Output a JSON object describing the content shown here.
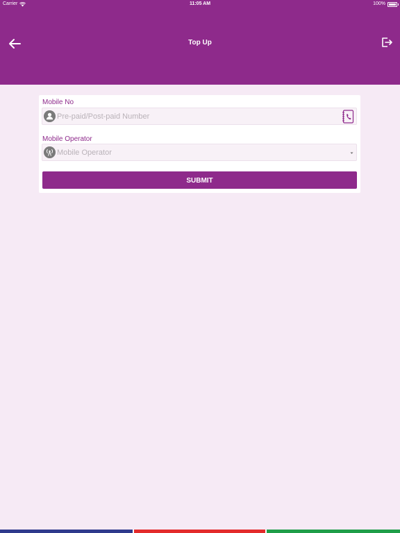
{
  "status_bar": {
    "carrier": "Carrier",
    "time": "11:05 AM",
    "battery": "100%"
  },
  "header": {
    "title": "Top Up",
    "back_icon": "arrow-left-icon",
    "logout_icon": "logout-icon"
  },
  "form": {
    "mobile_label": "Mobile No",
    "mobile_placeholder": "Pre-paid/Post-paid Number",
    "mobile_value": "",
    "operator_label": "Mobile Operator",
    "operator_placeholder": "Mobile Operator",
    "submit_label": "SUBMIT"
  },
  "colors": {
    "brand": "#8e2a8b",
    "background": "#f6eaf5",
    "stripe_blue": "#2e3a8c",
    "stripe_red": "#e32b2b",
    "stripe_green": "#1f9e49"
  }
}
